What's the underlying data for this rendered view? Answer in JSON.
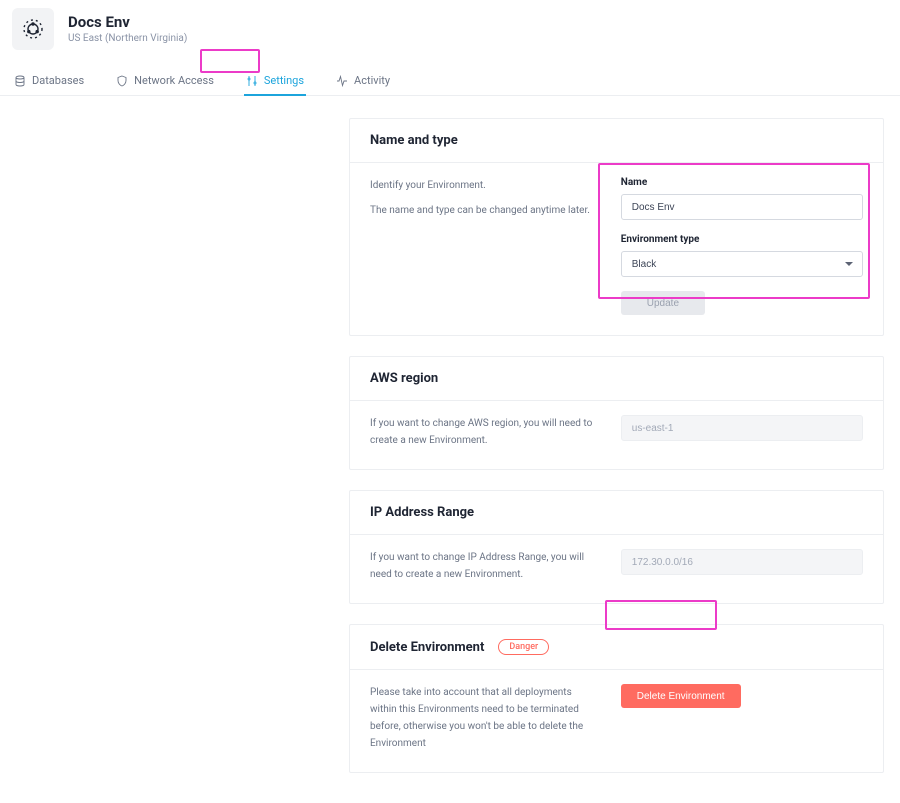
{
  "header": {
    "title": "Docs Env",
    "subtitle": "US East (Northern Virginia)"
  },
  "tabs": {
    "databases": "Databases",
    "network": "Network Access",
    "settings": "Settings",
    "activity": "Activity"
  },
  "name_card": {
    "title": "Name and type",
    "desc_line1": "Identify your Environment.",
    "desc_line2": "The name and type can be changed anytime later.",
    "name_label": "Name",
    "name_value": "Docs Env",
    "type_label": "Environment type",
    "type_value": "Black",
    "update_label": "Update"
  },
  "region_card": {
    "title": "AWS region",
    "desc": "If you want to change AWS region, you will need to create a new Environment.",
    "value": "us-east-1"
  },
  "ip_card": {
    "title": "IP Address Range",
    "desc": "If you want to change IP Address Range, you will need to create a new Environment.",
    "value": "172.30.0.0/16"
  },
  "delete_card": {
    "title": "Delete Environment",
    "badge": "Danger",
    "desc": "Please take into account that all deployments within this Environments need to be terminated before, otherwise you won't be able to delete the Environment",
    "button": "Delete Environment"
  },
  "colors": {
    "accent": "#1ca4dc",
    "danger": "#ff6b60",
    "highlight": "#ec3bc8"
  }
}
